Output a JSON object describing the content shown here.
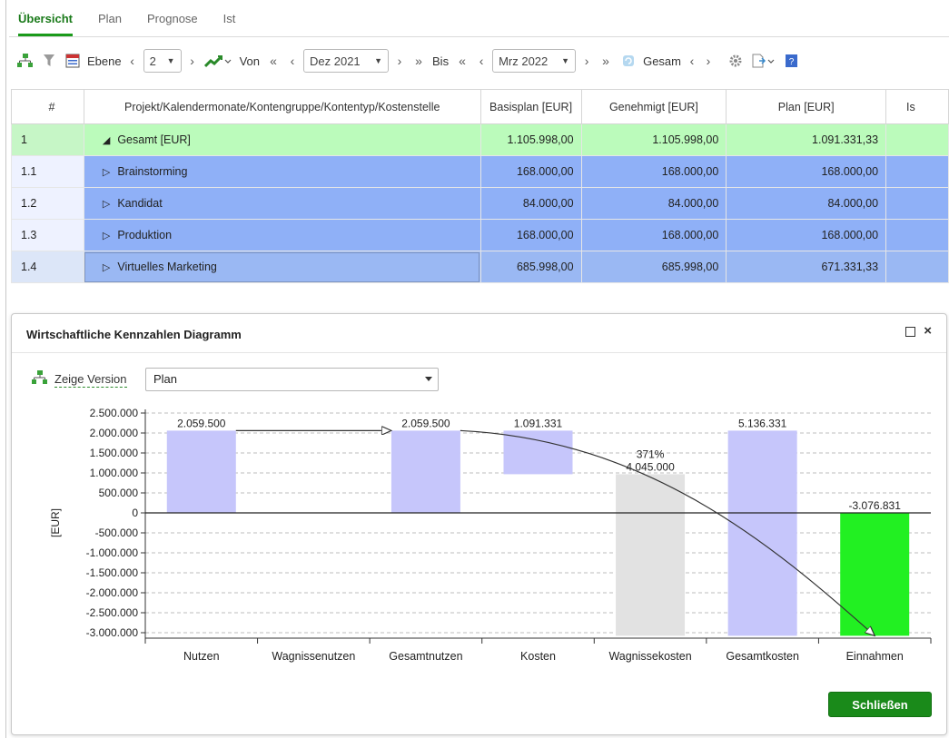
{
  "tabs": [
    {
      "label": "Übersicht",
      "active": true
    },
    {
      "label": "Plan",
      "active": false
    },
    {
      "label": "Prognose",
      "active": false
    },
    {
      "label": "Ist",
      "active": false
    }
  ],
  "toolbar": {
    "ebene_label": "Ebene",
    "ebene_value": "2",
    "von_label": "Von",
    "von_value": "Dez 2021",
    "bis_label": "Bis",
    "bis_value": "Mrz 2022",
    "gesam_label": "Gesam"
  },
  "grid": {
    "headers": [
      "#",
      "Projekt/Kalendermonate/Kontengruppe/Kontentyp/Kostenstelle",
      "Basisplan [EUR]",
      "Genehmigt [EUR]",
      "Plan [EUR]",
      "Is"
    ],
    "rows": [
      {
        "num": "1",
        "name": "Gesamt [EUR]",
        "basisplan": "1.105.998,00",
        "genehmigt": "1.105.998,00",
        "plan": "1.091.331,33",
        "marker": "◢",
        "kind": "total"
      },
      {
        "num": "1.1",
        "name": "Brainstorming",
        "basisplan": "168.000,00",
        "genehmigt": "168.000,00",
        "plan": "168.000,00",
        "marker": "▷",
        "kind": "blue"
      },
      {
        "num": "1.2",
        "name": "Kandidat",
        "basisplan": "84.000,00",
        "genehmigt": "84.000,00",
        "plan": "84.000,00",
        "marker": "▷",
        "kind": "blue"
      },
      {
        "num": "1.3",
        "name": "Produktion",
        "basisplan": "168.000,00",
        "genehmigt": "168.000,00",
        "plan": "168.000,00",
        "marker": "▷",
        "kind": "blue"
      },
      {
        "num": "1.4",
        "name": "Virtuelles Marketing",
        "basisplan": "685.998,00",
        "genehmigt": "685.998,00",
        "plan": "671.331,33",
        "marker": "▷",
        "kind": "sel"
      }
    ]
  },
  "dialog": {
    "title": "Wirtschaftliche Kennzahlen Diagramm",
    "version_label": "Zeige Version",
    "version_value": "Plan",
    "close_label": "Schließen"
  },
  "chart_data": {
    "type": "bar",
    "subtype": "waterfall",
    "ylabel": "[EUR]",
    "xlabel": "",
    "ylim": [
      -3000000,
      2500000
    ],
    "yticks": [
      2500000,
      2000000,
      1500000,
      1000000,
      500000,
      0,
      -500000,
      -1000000,
      -1500000,
      -2000000,
      -2500000,
      -3000000
    ],
    "ytick_labels": [
      "2.500.000",
      "2.000.000",
      "1.500.000",
      "1.000.000",
      "500.000",
      "0",
      "-500.000",
      "-1.000.000",
      "-1.500.000",
      "-2.000.000",
      "-2.500.000",
      "-3.000.000"
    ],
    "grid": true,
    "categories": [
      "Nutzen",
      "Wagnissenutzen",
      "Gesamtnutzen",
      "Kosten",
      "Wagnissekosten",
      "Gesamtkosten",
      "Einnahmen"
    ],
    "bars": [
      {
        "category": "Nutzen",
        "from": 0,
        "to": 2059500,
        "label": "2.059.500",
        "color": "#c6c6fb"
      },
      {
        "category": "Wagnissenutzen",
        "from": null,
        "to": null,
        "label": "",
        "color": ""
      },
      {
        "category": "Gesamtnutzen",
        "from": 0,
        "to": 2059500,
        "label": "2.059.500",
        "color": "#c6c6fb"
      },
      {
        "category": "Kosten",
        "from": 968169,
        "to": 2059500,
        "label": "1.091.331",
        "color": "#c6c6fb"
      },
      {
        "category": "Wagnissekosten",
        "from": -3076831,
        "to": 968169,
        "label": "4.045.000",
        "label2": "371%",
        "color": "#e2e2e2"
      },
      {
        "category": "Gesamtkosten",
        "from": -3076831,
        "to": 2059500,
        "label": "5.136.331",
        "color": "#c6c6fb"
      },
      {
        "category": "Einnahmen",
        "from": -3076831,
        "to": 0,
        "label": "-3.076.831",
        "color": "#22f022"
      }
    ],
    "arrows": [
      {
        "from_category": "Nutzen",
        "to_category": "Gesamtnutzen",
        "value": 2059500
      },
      {
        "from_category": "Gesamtnutzen",
        "to_category": "Einnahmen",
        "value_from": 2059500,
        "value_to": -3076831
      }
    ]
  }
}
